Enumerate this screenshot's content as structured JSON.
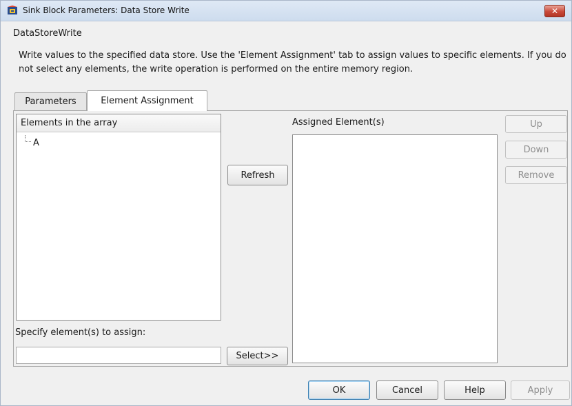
{
  "window": {
    "title": "Sink Block Parameters: Data Store Write",
    "close_label": "✕"
  },
  "group": {
    "label": "DataStoreWrite",
    "description": "Write values to the specified data store. Use the 'Element Assignment' tab to assign values to specific elements. If you do not select any elements, the write operation is performed on the entire memory region."
  },
  "tabs": [
    {
      "label": "Parameters",
      "active": false
    },
    {
      "label": "Element Assignment",
      "active": true
    }
  ],
  "elements_list": {
    "header": "Elements in the array",
    "items": [
      "A"
    ]
  },
  "refresh_label": "Refresh",
  "assigned": {
    "label": "Assigned Element(s)",
    "items": []
  },
  "side_buttons": {
    "up": "Up",
    "down": "Down",
    "remove": "Remove"
  },
  "specify": {
    "label": "Specify element(s) to assign:",
    "value": "",
    "select_label": "Select>>"
  },
  "footer": {
    "ok": "OK",
    "cancel": "Cancel",
    "help": "Help",
    "apply": "Apply"
  },
  "icons": {
    "title_icon": "simulink-block-icon",
    "close_icon": "close-icon"
  },
  "colors": {
    "close_button": "#c9493a",
    "titlebar": "#dfe9f5",
    "default_button_border": "#3c7fb1"
  }
}
